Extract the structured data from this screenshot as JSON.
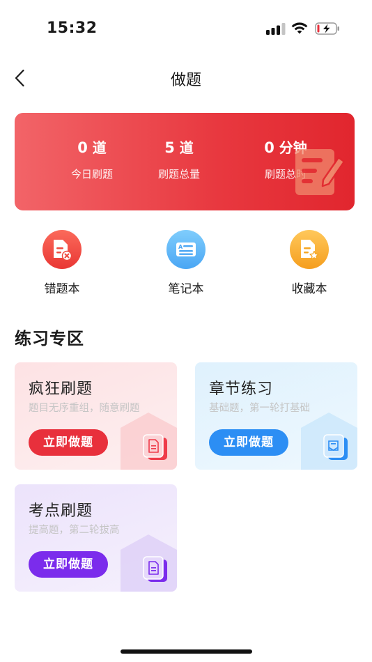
{
  "status_bar": {
    "time": "15:32"
  },
  "header": {
    "title": "做题"
  },
  "stats": [
    {
      "value": "0",
      "unit": "道",
      "label": "今日刷题"
    },
    {
      "value": "5",
      "unit": "道",
      "label": "刷题总量"
    },
    {
      "value": "0",
      "unit": "分钟",
      "label": "刷题总时"
    }
  ],
  "tools": [
    {
      "label": "错题本",
      "icon": "wrong-book-icon"
    },
    {
      "label": "笔记本",
      "icon": "notebook-icon"
    },
    {
      "label": "收藏本",
      "icon": "favorites-icon"
    }
  ],
  "section": {
    "title": "练习专区"
  },
  "practice_cards": [
    {
      "title": "疯狂刷题",
      "subtitle": "题目无序重组，随意刷题",
      "button": "立即做题",
      "color": "#e8303c"
    },
    {
      "title": "章节练习",
      "subtitle": "基础题，第一轮打基础",
      "button": "立即做题",
      "color": "#2c8ef4"
    },
    {
      "title": "考点刷题",
      "subtitle": "提高题，第二轮拔高",
      "button": "立即做题",
      "color": "#7b2cec"
    }
  ]
}
